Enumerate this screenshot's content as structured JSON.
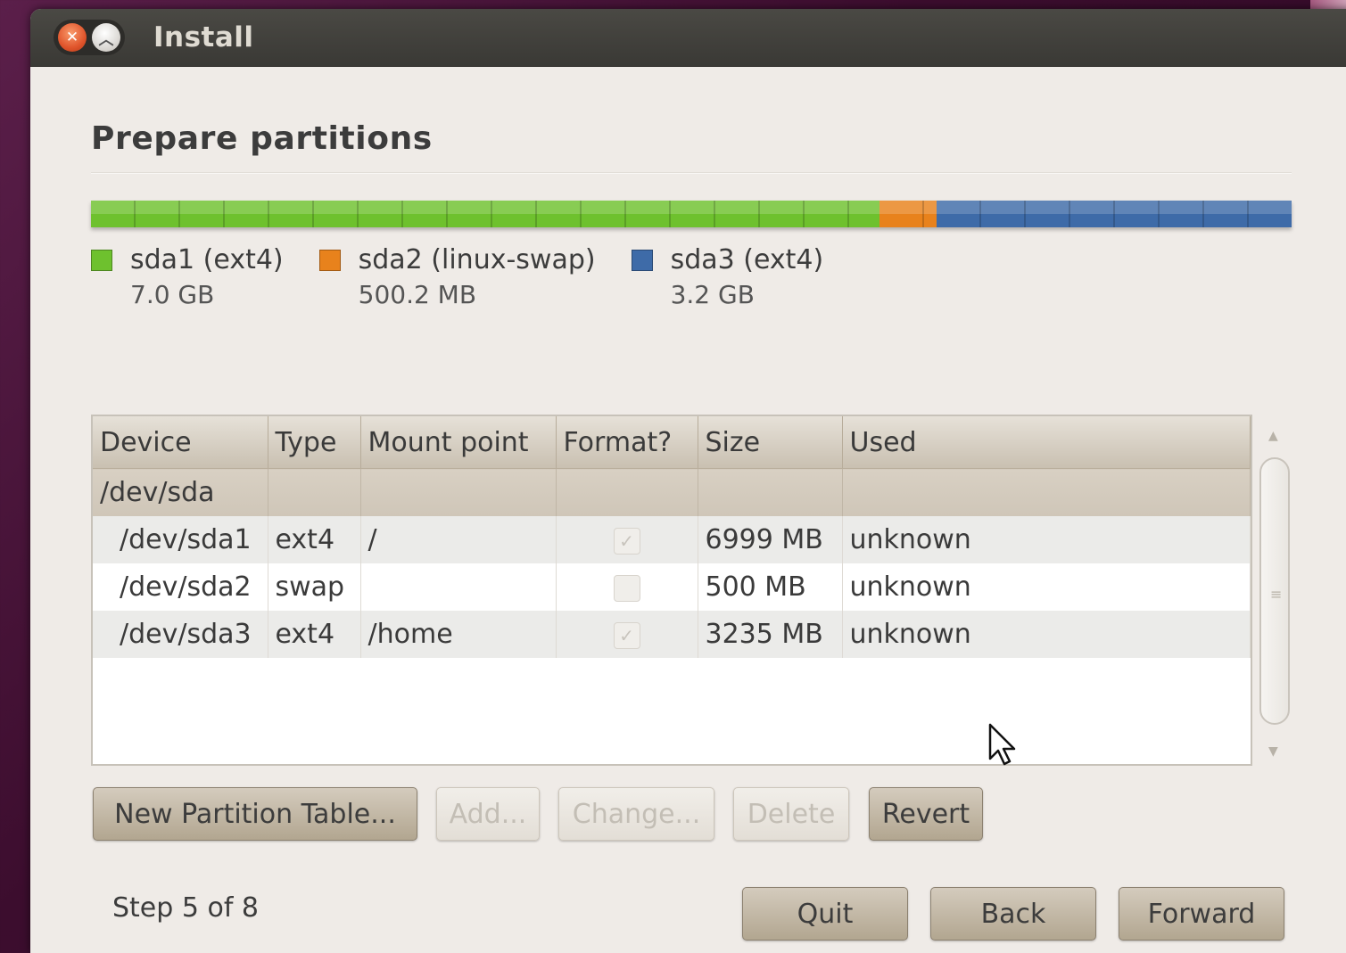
{
  "window": {
    "title": "Install"
  },
  "page": {
    "heading": "Prepare partitions"
  },
  "partition_bar": [
    {
      "name": "sda1 (ext4)",
      "size": "7.0 GB",
      "color": "#6ec12e",
      "fraction": 0.6567
    },
    {
      "name": "sda2 (linux-swap)",
      "size": "500.2 MB",
      "color": "#e8821c",
      "fraction": 0.0475
    },
    {
      "name": "sda3 (ext4)",
      "size": "3.2 GB",
      "color": "#3e6ba8",
      "fraction": 0.2958
    }
  ],
  "table": {
    "columns": [
      "Device",
      "Type",
      "Mount point",
      "Format?",
      "Size",
      "Used"
    ],
    "group": "/dev/sda",
    "rows": [
      {
        "device": "/dev/sda1",
        "type": "ext4",
        "mount": "/",
        "format": true,
        "size": "6999 MB",
        "used": "unknown"
      },
      {
        "device": "/dev/sda2",
        "type": "swap",
        "mount": "",
        "format": false,
        "size": "500 MB",
        "used": "unknown"
      },
      {
        "device": "/dev/sda3",
        "type": "ext4",
        "mount": "/home",
        "format": true,
        "size": "3235 MB",
        "used": "unknown"
      }
    ]
  },
  "actions": {
    "new_table": "New Partition Table...",
    "add": "Add...",
    "change": "Change...",
    "delete": "Delete",
    "revert": "Revert"
  },
  "footer": {
    "step": "Step 5 of 8",
    "quit": "Quit",
    "back": "Back",
    "forward": "Forward"
  },
  "icons": {
    "close": "close-icon",
    "maximize": "maximize-icon",
    "cursor": "mouse-pointer-icon"
  }
}
